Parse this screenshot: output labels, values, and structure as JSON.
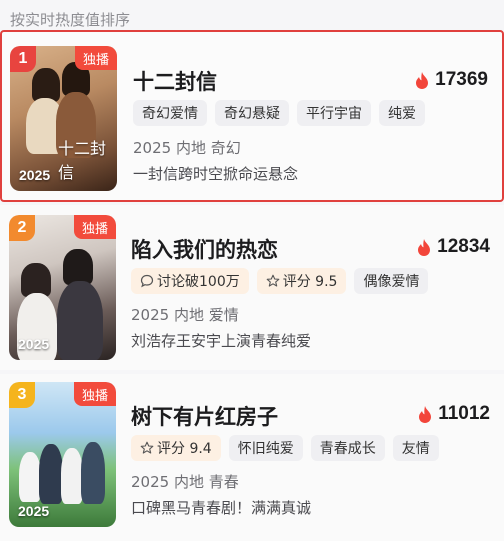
{
  "header": {
    "title": "按实时热度值排序"
  },
  "items": [
    {
      "rank": "1",
      "badge": "独播",
      "poster_year": "2025",
      "poster_title": "十二封信",
      "title": "十二封信",
      "heat": "17369",
      "tags": [
        {
          "label": "奇幻爱情"
        },
        {
          "label": "奇幻悬疑"
        },
        {
          "label": "平行宇宙"
        },
        {
          "label": "纯爱"
        }
      ],
      "meta": "2025 内地 奇幻",
      "desc": "一封信跨时空掀命运悬念"
    },
    {
      "rank": "2",
      "badge": "独播",
      "poster_year": "2025",
      "title": "陷入我们的热恋",
      "heat": "12834",
      "tags": [
        {
          "label": "讨论破100万",
          "icon": "comment-icon"
        },
        {
          "label": "评分 9.5",
          "icon": "star-icon"
        },
        {
          "label": "偶像爱情"
        }
      ],
      "meta": "2025 内地 爱情",
      "desc": "刘浩存王安宇上演青春纯爱"
    },
    {
      "rank": "3",
      "badge": "独播",
      "poster_year": "2025",
      "title": "树下有片红房子",
      "heat": "11012",
      "tags": [
        {
          "label": "评分 9.4",
          "icon": "star-icon"
        },
        {
          "label": "怀旧纯爱"
        },
        {
          "label": "青春成长"
        },
        {
          "label": "友情"
        }
      ],
      "meta": "2025 内地 青春",
      "desc": "口碑黑马青春剧！满满真诚"
    }
  ],
  "colors": {
    "highlight_border": "#e0403d",
    "rank1": "#e8443f",
    "rank2": "#f28a2e",
    "rank3": "#f5b41d",
    "flame": "#f2453a"
  }
}
